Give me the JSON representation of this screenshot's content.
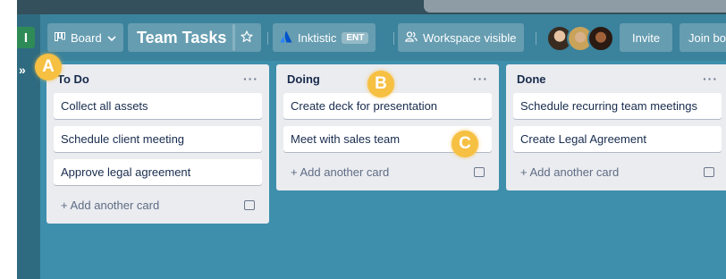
{
  "header": {
    "view_switcher": "Board",
    "board_title": "Team Tasks",
    "workspace_name": "Inktistic",
    "workspace_badge": "ENT",
    "visibility": "Workspace visible",
    "invite": "Invite",
    "join": "Join bo"
  },
  "sidebar": {
    "workspace_initial": "I",
    "expand_glyph": "»"
  },
  "lists": [
    {
      "title": "To Do",
      "menu": "···",
      "cards": [
        "Collect all assets",
        "Schedule client meeting",
        "Approve legal agreement"
      ],
      "add_label": "+ Add another card"
    },
    {
      "title": "Doing",
      "menu": "···",
      "cards": [
        "Create deck for presentation",
        "Meet with sales team"
      ],
      "add_label": "+ Add another card"
    },
    {
      "title": "Done",
      "menu": "···",
      "cards": [
        "Schedule recurring team meetings",
        "Create Legal Agreement"
      ],
      "add_label": "+ Add another card"
    }
  ],
  "markers": [
    "A",
    "B",
    "C"
  ],
  "colors": {
    "board_bg": "#3e8fac",
    "sidebar_bg": "#2f6b80",
    "workspace_badge_bg": "#2e8b57",
    "list_bg": "#ebecf0",
    "marker": "#f6c043",
    "atlassian_blue": "#2684ff"
  },
  "icons": {
    "view_switcher": "board-icon",
    "star": "star-icon",
    "workspace": "atlassian-logo-icon",
    "visibility": "people-icon",
    "list_menu": "ellipsis-icon",
    "card_template": "card-template-icon"
  }
}
